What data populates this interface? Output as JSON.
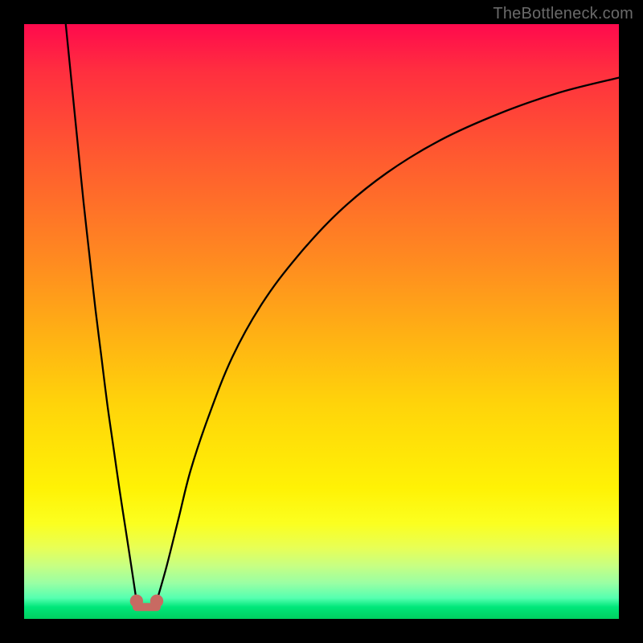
{
  "watermark": "TheBottleneck.com",
  "colors": {
    "page_bg": "#000000",
    "gradient_top": "#ff0a4d",
    "gradient_bottom": "#00d060",
    "curve": "#000000",
    "marker": "#c86a62"
  },
  "chart_data": {
    "type": "line",
    "title": "",
    "xlabel": "",
    "ylabel": "",
    "xlim": [
      0,
      100
    ],
    "ylim": [
      0,
      100
    ],
    "grid": false,
    "legend": false,
    "notes": "Bottleneck-style V-curve; no axis ticks or numeric labels are rendered. Values are estimated from pixel positions (y=0 bottom, y=100 top).",
    "series": [
      {
        "name": "left-descent",
        "x": [
          7,
          8,
          9,
          10,
          11,
          12,
          13,
          14,
          15,
          16,
          17,
          18,
          18.9
        ],
        "y": [
          100,
          90,
          80,
          70,
          61,
          52,
          44,
          36,
          29,
          22,
          15.5,
          9,
          3
        ]
      },
      {
        "name": "right-ascent",
        "x": [
          22.3,
          24,
          26,
          28,
          31,
          35,
          40,
          46,
          53,
          61,
          70,
          80,
          90,
          100
        ],
        "y": [
          3,
          9,
          17,
          25,
          34,
          44,
          53,
          61,
          68.5,
          75,
          80.5,
          85,
          88.5,
          91
        ]
      }
    ],
    "markers": [
      {
        "name": "valley-left",
        "x": 18.9,
        "y": 3,
        "r": 1.1
      },
      {
        "name": "valley-right",
        "x": 22.3,
        "y": 3,
        "r": 1.1
      }
    ],
    "valley_connector": {
      "x1": 18.9,
      "y1": 2,
      "x2": 22.3,
      "y2": 2
    }
  }
}
